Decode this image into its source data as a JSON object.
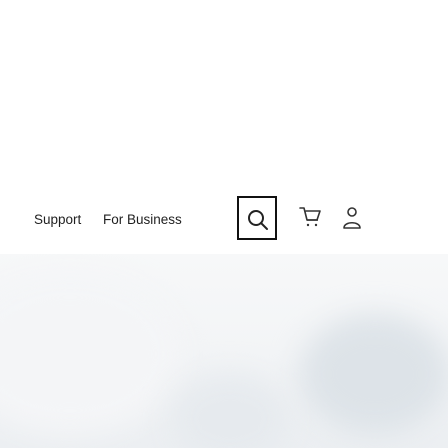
{
  "nav": {
    "support_label": "Support",
    "business_label": "For Business"
  },
  "icons": {
    "search": "search-icon",
    "cart": "cart-icon",
    "account": "user-icon"
  },
  "colors": {
    "text": "#1f1f1f",
    "border": "#111111",
    "background": "#ffffff"
  }
}
